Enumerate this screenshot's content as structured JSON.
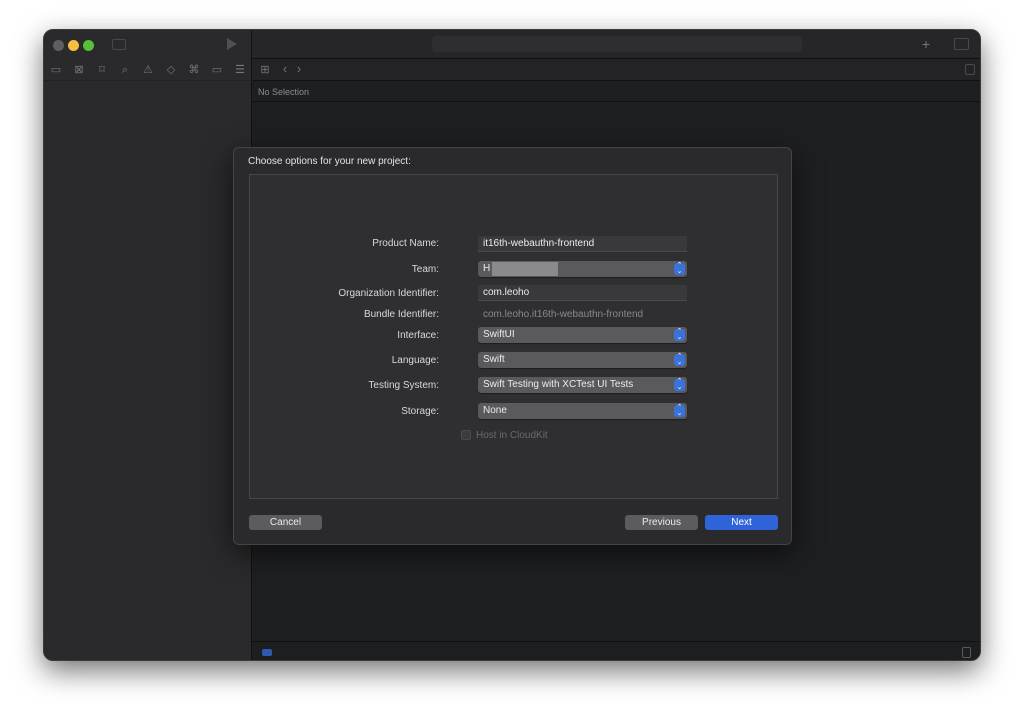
{
  "window": {
    "no_selection": "No Selection"
  },
  "toolbar_icons": [
    "folder-icon",
    "source-control-icon",
    "bookmark-icon",
    "search-icon",
    "warning-icon",
    "test-icon",
    "debug-icon",
    "breakpoint-icon",
    "report-icon"
  ],
  "dialog": {
    "title": "Choose options for your new project:",
    "fields": [
      {
        "label": "Product Name:",
        "value": "it16th-webauthn-frontend",
        "type": "text"
      },
      {
        "label": "Team:",
        "value": "H            en",
        "type": "popup"
      },
      {
        "label": "Organization Identifier:",
        "value": "com.leoho",
        "type": "text"
      },
      {
        "label": "Bundle Identifier:",
        "value": "com.leoho.it16th-webauthn-frontend",
        "type": "static"
      },
      {
        "label": "Interface:",
        "value": "SwiftUI",
        "type": "popup"
      },
      {
        "label": "Language:",
        "value": "Swift",
        "type": "popup"
      },
      {
        "label": "Testing System:",
        "value": "Swift Testing with XCTest UI Tests",
        "type": "popup"
      },
      {
        "label": "Storage:",
        "value": "None",
        "type": "popup"
      }
    ],
    "checkbox": {
      "label": "Host in CloudKit",
      "checked": false,
      "disabled": true
    },
    "buttons": {
      "cancel": "Cancel",
      "previous": "Previous",
      "next": "Next"
    },
    "accent": "#2f63d8"
  }
}
